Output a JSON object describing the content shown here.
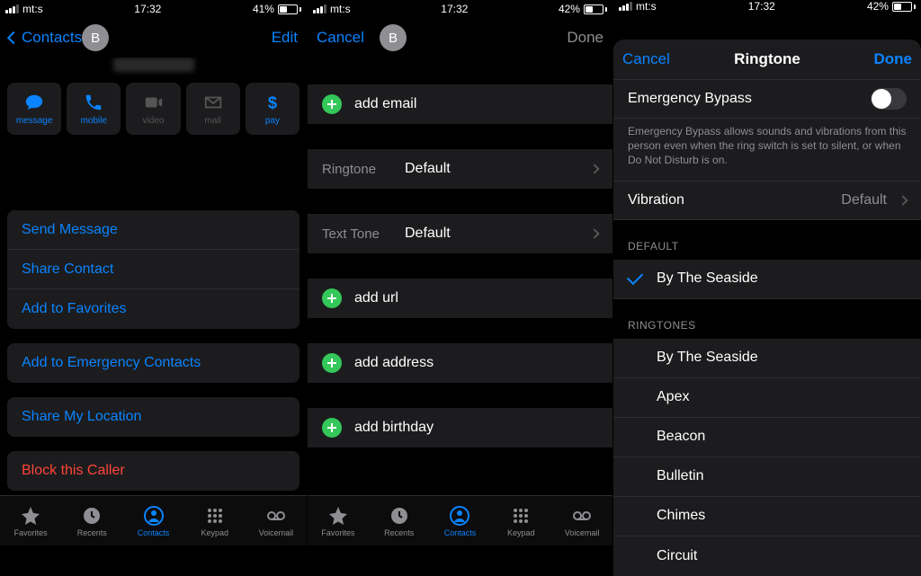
{
  "status": {
    "carrier": "mt:s",
    "time": "17:32",
    "batt1": "41%",
    "batt2": "42%",
    "batt3": "42%"
  },
  "pane1": {
    "back": "Contacts",
    "edit": "Edit",
    "avatar_letter": "B",
    "actions": {
      "message": "message",
      "mobile": "mobile",
      "video": "video",
      "mail": "mail",
      "pay": "pay"
    },
    "rows": {
      "send_message": "Send Message",
      "share_contact": "Share Contact",
      "add_fav": "Add to Favorites",
      "add_emerg": "Add to Emergency Contacts",
      "share_loc": "Share My Location",
      "block": "Block this Caller"
    },
    "tabs": {
      "favorites": "Favorites",
      "recents": "Recents",
      "contacts": "Contacts",
      "keypad": "Keypad",
      "voicemail": "Voicemail"
    }
  },
  "pane2": {
    "cancel": "Cancel",
    "done": "Done",
    "avatar_letter": "B",
    "add_email": "add email",
    "ringtone_key": "Ringtone",
    "ringtone_val": "Default",
    "texttone_key": "Text Tone",
    "texttone_val": "Default",
    "add_url": "add url",
    "add_address": "add address",
    "add_birthday": "add birthday",
    "tabs": {
      "favorites": "Favorites",
      "recents": "Recents",
      "contacts": "Contacts",
      "keypad": "Keypad",
      "voicemail": "Voicemail"
    }
  },
  "pane3": {
    "cancel": "Cancel",
    "title": "Ringtone",
    "done": "Done",
    "emergency": "Emergency Bypass",
    "emergency_desc": "Emergency Bypass allows sounds and vibrations from this person even when the ring switch is set to silent, or when Do Not Disturb is on.",
    "vibration": "Vibration",
    "vibration_val": "Default",
    "section_default": "DEFAULT",
    "selected": "By The Seaside",
    "section_ringtones": "RINGTONES",
    "ringtones": [
      "By The Seaside",
      "Apex",
      "Beacon",
      "Bulletin",
      "Chimes",
      "Circuit"
    ]
  }
}
